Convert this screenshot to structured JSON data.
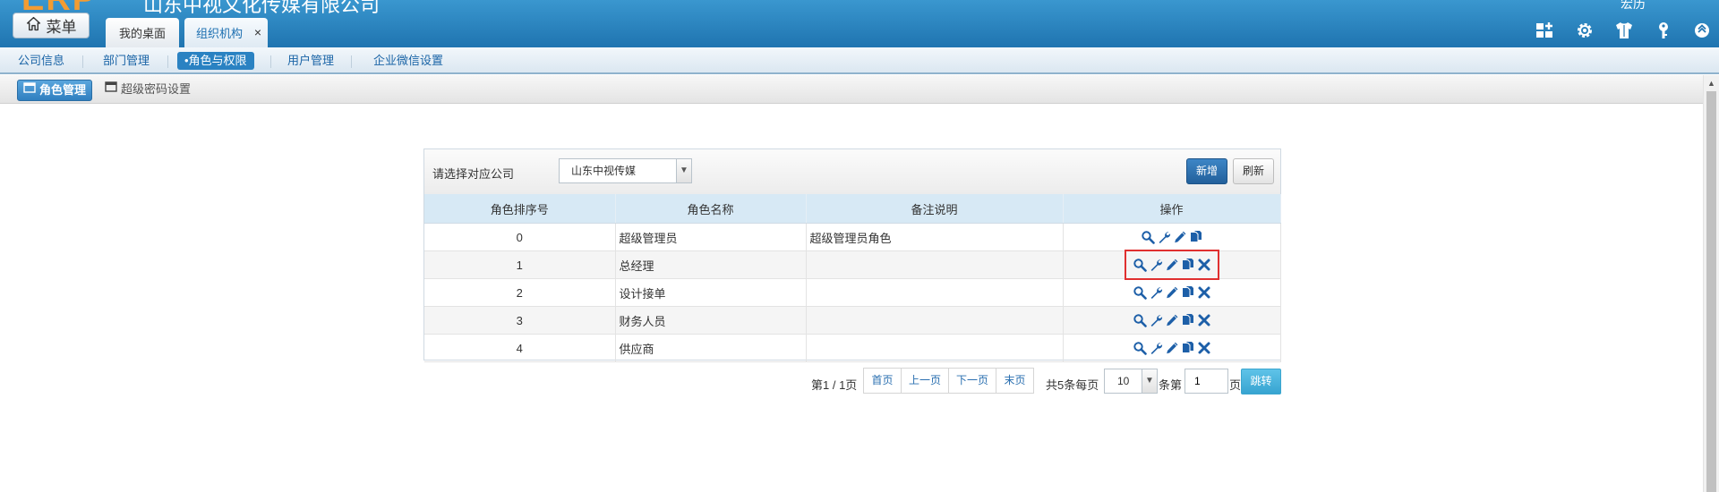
{
  "header": {
    "logo_text": "ERP",
    "company_name": "山东中视文化传媒有限公司",
    "user_name": "宏历",
    "menu_label": "菜单",
    "tabs": [
      {
        "label": "我的桌面"
      },
      {
        "label": "组织机构",
        "close": "×"
      }
    ],
    "icons": [
      "grid-add-icon",
      "gear-icon",
      "shirt-icon",
      "key-icon",
      "chevron-up-circle-icon"
    ]
  },
  "nav": {
    "items": [
      {
        "label": "公司信息"
      },
      {
        "label": "部门管理"
      },
      {
        "label": "•角色与权限"
      },
      {
        "label": "用户管理"
      },
      {
        "label": "企业微信设置"
      }
    ]
  },
  "subtabs": {
    "role_manage": "角色管理",
    "super_password": "超级密码设置"
  },
  "toolbar": {
    "company_label": "请选择对应公司",
    "company_selected": "山东中视传媒",
    "add_label": "新增",
    "refresh_label": "刷新"
  },
  "table": {
    "columns": [
      "角色排序号",
      "角色名称",
      "备注说明",
      "操作"
    ],
    "rows": [
      {
        "order": "0",
        "name": "超级管理员",
        "note": "超级管理员角色",
        "ops": [
          "view",
          "settings",
          "edit",
          "copy"
        ]
      },
      {
        "order": "1",
        "name": "总经理",
        "note": "",
        "ops": [
          "view",
          "settings",
          "edit",
          "copy",
          "delete"
        ]
      },
      {
        "order": "2",
        "name": "设计接单",
        "note": "",
        "ops": [
          "view",
          "settings",
          "edit",
          "copy",
          "delete"
        ]
      },
      {
        "order": "3",
        "name": "财务人员",
        "note": "",
        "ops": [
          "view",
          "settings",
          "edit",
          "copy",
          "delete"
        ]
      },
      {
        "order": "4",
        "name": "供应商",
        "note": "",
        "ops": [
          "view",
          "settings",
          "edit",
          "copy",
          "delete"
        ]
      }
    ]
  },
  "pagination": {
    "page_info": "第1 / 1页",
    "first": "首页",
    "prev": "上一页",
    "next": "下一页",
    "last": "末页",
    "total_per_page": "共5条每页",
    "page_size": "10",
    "goto_prefix": "条第",
    "current_page": "1",
    "page_suffix": "页",
    "jump": "跳转"
  },
  "colors": {
    "header_top": "#3a97cf",
    "header_bottom": "#1f74b0",
    "logo": "#f39c32",
    "icon_blue": "#1d5fa8",
    "highlight": "#e03030"
  }
}
